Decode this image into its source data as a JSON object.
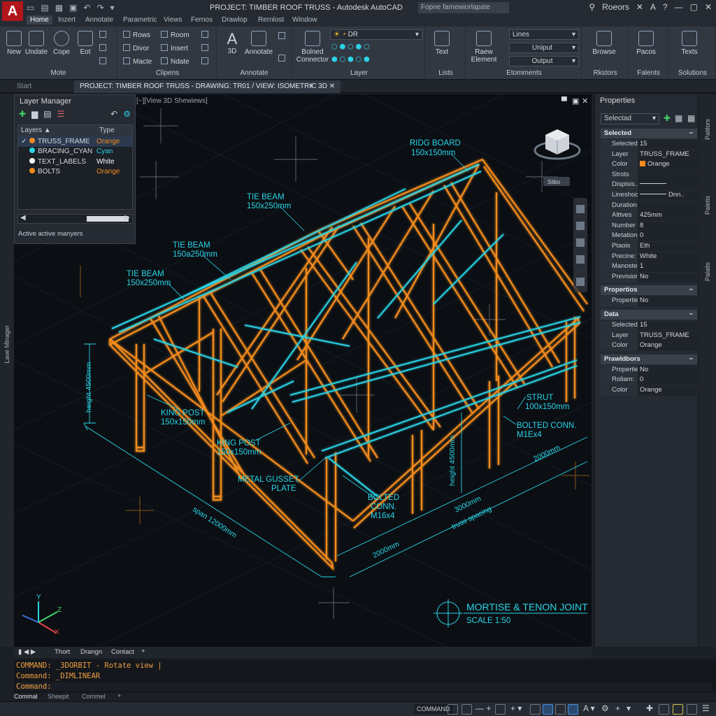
{
  "app": {
    "title": "PROJECT: TIMBER ROOF TRUSS - Autodesk AutoCAD",
    "logo": "A",
    "search_placeholder": "Fopne famewiorlapate",
    "user": "Roeors",
    "help": "?"
  },
  "ribbon_tabs": [
    "Home",
    "Inzert",
    "Annotate",
    "Parametric",
    "Views",
    "Fernos",
    "Drawlop",
    "Rernlost",
    "Window"
  ],
  "ribbon": {
    "mote": {
      "title": "Mote",
      "buttons": [
        "New",
        "Undate",
        "Cope",
        "Eot"
      ]
    },
    "clipens": {
      "title": "Clipens",
      "items": [
        "Rows",
        "Divor",
        "Macte",
        "Room",
        "Insert",
        "Ndate"
      ]
    },
    "annotate": {
      "title": "Annotate",
      "buttons": [
        "3D",
        "Annotate"
      ]
    },
    "layer": {
      "title": "Layer",
      "button": "Bolned Connector",
      "dropdown": "DR"
    },
    "lists": {
      "title": "Lists",
      "button": "Text"
    },
    "elements": {
      "title": "Etomments",
      "button": "Raew Element",
      "dropdowns": [
        "Lines",
        "Uniput",
        "Output"
      ]
    },
    "rkstors": {
      "title": "Rkstors",
      "button": "Browse"
    },
    "falents": {
      "title": "Falents",
      "button": "Pacos"
    },
    "solutions": {
      "title": "Solutions",
      "button": "Texts"
    }
  },
  "doc_tabs": {
    "start": "Start",
    "active": "PROJECT: TIMBER ROOF TRUSS - DRAWING: TR01 / VIEW: ISOMETRIC 3D"
  },
  "viewport": {
    "label": "[−][View 3D Shewiews]",
    "viewcube_label": "Sitbo",
    "annotations": {
      "ridge": [
        "RIDG BOARD",
        "150x150mm"
      ],
      "tie1": [
        "TIE BEAM",
        "150x250mm"
      ],
      "tie2": [
        "TIE BEAM",
        "150a250mm"
      ],
      "tie3": [
        "TIE BEAM",
        "150x250mm"
      ],
      "king1": [
        "KING POST",
        "150x150mm"
      ],
      "king2": [
        "KING POST",
        "150x150mm"
      ],
      "gusset": [
        "METAL GUSSET",
        "PLATE"
      ],
      "bolted1": [
        "BOLTED",
        "CONN.",
        "M16x4"
      ],
      "bolted2": [
        "BOLTED CONN.",
        "M1Ex4"
      ],
      "strut": [
        "STRUT",
        "100x150mm"
      ],
      "height1": "height 4500mm",
      "height2": "height 4500mm",
      "span": "span 12000mm",
      "dim1": "2000mm",
      "dim2": "2000mm",
      "dim3": "3000mm",
      "truss_spacing": "truss spacing",
      "joint_title": "MORTISE & TENON JOINT",
      "joint_scale": "SCALE 1:50"
    },
    "ucs": {
      "x": "X",
      "y": "Y",
      "z": "Z"
    }
  },
  "layer_manager": {
    "title": "Layer Manager",
    "columns": [
      "Layers",
      "Type"
    ],
    "rows": [
      {
        "name": "TRUSS_FRAME",
        "type": "Orange",
        "color": "#f28b1e",
        "checked": true
      },
      {
        "name": "BRACING_CYAN",
        "type": "Cyan",
        "color": "#2ad4e6",
        "checked": false
      },
      {
        "name": "TEXT_LABELS",
        "type": "White",
        "color": "#ffffff",
        "checked": false
      },
      {
        "name": "BOLTS",
        "type": "Orange",
        "color": "#f28b1e",
        "checked": false
      }
    ],
    "status": "Active active manyers"
  },
  "side_labels": {
    "left": "Lave Mlnager",
    "right1": "Paltlors",
    "right2": "Paletis",
    "right3": "Palalts"
  },
  "properties": {
    "title": "Properties",
    "selector": "Selectad",
    "sections": [
      {
        "name": "Selected",
        "rows": [
          [
            "Selected",
            "15"
          ],
          [
            "Layer",
            "TRUSS_FRAME"
          ],
          [
            "Color",
            "Orange"
          ],
          [
            "Strots",
            ""
          ],
          [
            "Displsis...",
            ""
          ],
          [
            "Lineshoot",
            "Dnn.."
          ],
          [
            "Duration",
            ""
          ],
          [
            "Alttves",
            "425mm"
          ],
          [
            "Number",
            "8"
          ],
          [
            "Metations",
            "0"
          ],
          [
            "Ptaois",
            "Eth"
          ],
          [
            "Precine:",
            "White"
          ],
          [
            "Manosted.",
            "1"
          ],
          [
            "Prevision...",
            "No"
          ]
        ]
      },
      {
        "name": "Propertios",
        "rows": [
          [
            "Propertie...",
            "No"
          ]
        ]
      },
      {
        "name": "Data",
        "rows": [
          [
            "Selected",
            "15"
          ],
          [
            "Layer",
            "TRUSS_FRAME"
          ],
          [
            "Color",
            "Orange"
          ]
        ]
      },
      {
        "name": "Prawldbors",
        "rows": [
          [
            "Properties",
            "No"
          ],
          [
            "Roliam:",
            "0"
          ],
          [
            "Color",
            "Orange"
          ]
        ]
      }
    ]
  },
  "layout_tabs": [
    "Thort",
    "Drangn",
    "Contact",
    "+"
  ],
  "command": {
    "lines": [
      "COMMAND: _3DORBIT - Rotate view |",
      "Command: _DIMLINEAR",
      "Command:"
    ]
  },
  "bottom_tabs": [
    "Commal",
    "Sheepit",
    "Commel",
    "+"
  ],
  "statusbar": {
    "label": "COMMAND"
  },
  "colors": {
    "orange": "#f28b1e",
    "cyan": "#2ad4e6",
    "bg": "#0b0f14",
    "panel": "#262b33",
    "accent_red": "#b0161b"
  }
}
